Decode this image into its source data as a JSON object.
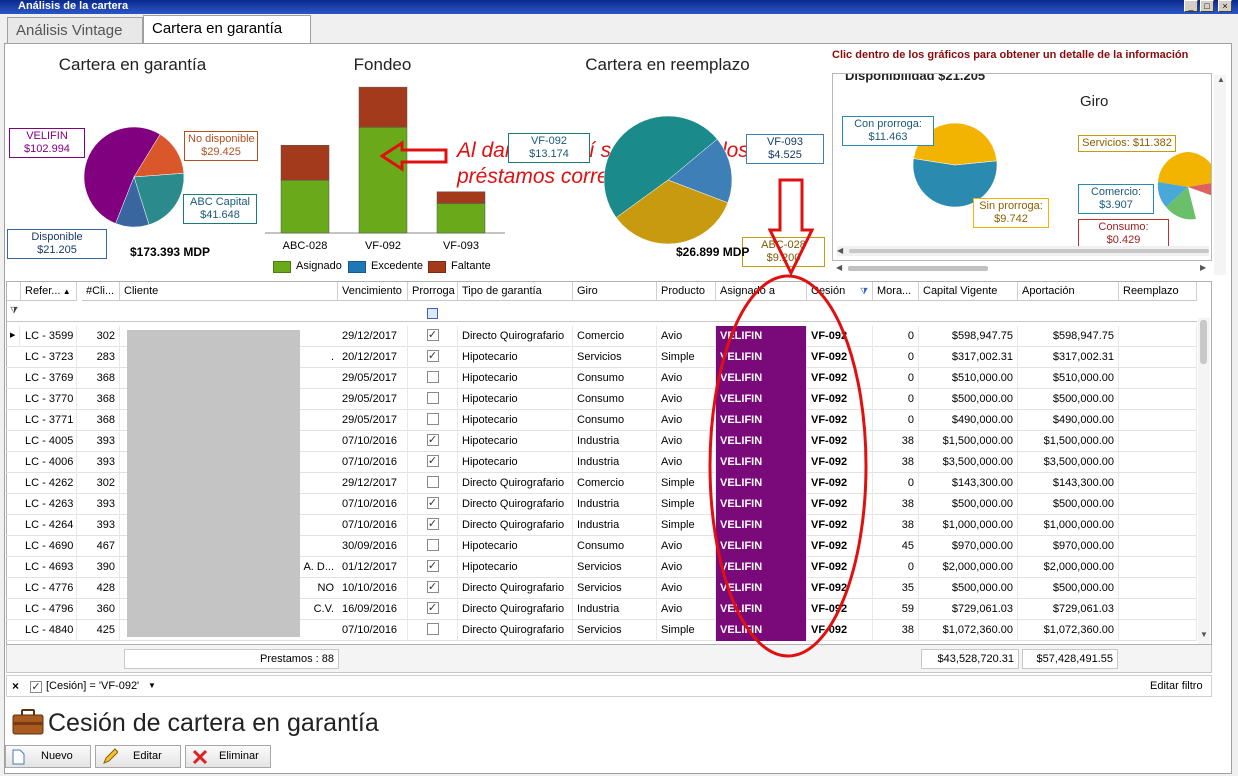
{
  "window": {
    "title": "Análisis de la cartera"
  },
  "tabs": [
    {
      "label": "Análisis Vintage"
    },
    {
      "label": "Cartera en garantía"
    }
  ],
  "charts": {
    "garantia": {
      "title": "Cartera en garantía",
      "total": "$173.393 MDP",
      "labels": {
        "velifin": "VELIFIN\n$102.994",
        "no_disp": "No disponible\n$29.425",
        "abc": "ABC Capital\n$41.648",
        "disp": "Disponible $21.205"
      }
    },
    "fondeo": {
      "title": "Fondeo",
      "annotation": "Al dar clic aquí se muestran los préstamos correspondientes",
      "legend": [
        "Asignado",
        "Excedente",
        "Faltante"
      ]
    },
    "reemplazo": {
      "title": "Cartera en reemplazo",
      "total": "$26.899 MDP",
      "labels": {
        "vf092": "VF-092 $13.174",
        "vf093": "VF-093 $4.525",
        "abc028": "ABC-028 $9.200"
      }
    },
    "detail_hint": "Clic dentro de los gráficos para obtener un detalle de la información",
    "disponibilidad": {
      "title": "Disponibilidad $21.205",
      "giro": "Giro",
      "labels": {
        "con": "Con prorroga:\n$11.463",
        "sin": "Sin prorroga:\n$9.742",
        "servicios": "Servicios: $11.382",
        "comercio": "Comercio:\n$3.907",
        "consumo": "Consumo: $0.429"
      }
    }
  },
  "chart_data": [
    {
      "type": "pie",
      "title": "Cartera en garantía",
      "categories": [
        "VELIFIN",
        "No disponible",
        "ABC Capital",
        "Disponible"
      ],
      "values": [
        102.994,
        29.425,
        41.648,
        21.205
      ],
      "colors": [
        "#800080",
        "#d9572b",
        "#2a8a8c",
        "#3a66a0"
      ]
    },
    {
      "type": "bar",
      "title": "Fondeo",
      "categories": [
        "ABC-028",
        "VF-092",
        "VF-093"
      ],
      "series": [
        {
          "name": "Asignado",
          "values": [
            50,
            100,
            28
          ],
          "color": "#6aaa1a"
        },
        {
          "name": "Excedente",
          "values": [
            0,
            0,
            0
          ],
          "color": "#1f78b4"
        },
        {
          "name": "Faltante",
          "values": [
            33,
            38,
            11
          ],
          "color": "#a33a1c"
        }
      ],
      "ylim": [
        0,
        140
      ]
    },
    {
      "type": "pie",
      "title": "Cartera en reemplazo",
      "categories": [
        "VF-092",
        "VF-093",
        "ABC-028"
      ],
      "values": [
        13.174,
        4.525,
        9.2
      ],
      "colors": [
        "#1a8a8a",
        "#3f7fb8",
        "#c89a10"
      ]
    },
    {
      "type": "pie",
      "title": "Disponibilidad $21.205",
      "categories": [
        "Con prorroga",
        "Sin prorroga"
      ],
      "values": [
        11.463,
        9.742
      ],
      "colors": [
        "#2b8ab0",
        "#f2b400"
      ]
    }
  ],
  "table": {
    "headers": [
      "Refer...",
      "#Cli...",
      "Cliente",
      "Vencimiento",
      "Prorroga",
      "Tipo de garantía",
      "Giro",
      "Producto",
      "Asignado a",
      "Cesión",
      "Mora...",
      "Capital Vigente",
      "Aportación",
      "Reemplazo"
    ],
    "rows": [
      {
        "ref": "LC - 3599",
        "cli": "302",
        "suffix": "",
        "venc": "29/12/2017",
        "pro": true,
        "tipo": "Directo Quirografario",
        "giro": "Comercio",
        "prod": "Avio",
        "asig": "VELIFIN",
        "ces": "VF-092",
        "mora": "0",
        "cap": "$598,947.75",
        "apo": "$598,947.75"
      },
      {
        "ref": "LC - 3723",
        "cli": "283",
        "suffix": ".",
        "venc": "20/12/2017",
        "pro": true,
        "tipo": "Hipotecario",
        "giro": "Servicios",
        "prod": "Simple",
        "asig": "VELIFIN",
        "ces": "VF-092",
        "mora": "0",
        "cap": "$317,002.31",
        "apo": "$317,002.31"
      },
      {
        "ref": "LC - 3769",
        "cli": "368",
        "suffix": "",
        "venc": "29/05/2017",
        "pro": false,
        "tipo": "Hipotecario",
        "giro": "Consumo",
        "prod": "Avio",
        "asig": "VELIFIN",
        "ces": "VF-092",
        "mora": "0",
        "cap": "$510,000.00",
        "apo": "$510,000.00"
      },
      {
        "ref": "LC - 3770",
        "cli": "368",
        "suffix": "",
        "venc": "29/05/2017",
        "pro": false,
        "tipo": "Hipotecario",
        "giro": "Consumo",
        "prod": "Avio",
        "asig": "VELIFIN",
        "ces": "VF-092",
        "mora": "0",
        "cap": "$500,000.00",
        "apo": "$500,000.00"
      },
      {
        "ref": "LC - 3771",
        "cli": "368",
        "suffix": "",
        "venc": "29/05/2017",
        "pro": false,
        "tipo": "Hipotecario",
        "giro": "Consumo",
        "prod": "Avio",
        "asig": "VELIFIN",
        "ces": "VF-092",
        "mora": "0",
        "cap": "$490,000.00",
        "apo": "$490,000.00"
      },
      {
        "ref": "LC - 4005",
        "cli": "393",
        "suffix": "",
        "venc": "07/10/2016",
        "pro": true,
        "tipo": "Hipotecario",
        "giro": "Industria",
        "prod": "Avio",
        "asig": "VELIFIN",
        "ces": "VF-092",
        "mora": "38",
        "cap": "$1,500,000.00",
        "apo": "$1,500,000.00"
      },
      {
        "ref": "LC - 4006",
        "cli": "393",
        "suffix": "",
        "venc": "07/10/2016",
        "pro": true,
        "tipo": "Hipotecario",
        "giro": "Industria",
        "prod": "Avio",
        "asig": "VELIFIN",
        "ces": "VF-092",
        "mora": "38",
        "cap": "$3,500,000.00",
        "apo": "$3,500,000.00"
      },
      {
        "ref": "LC - 4262",
        "cli": "302",
        "suffix": "",
        "venc": "29/12/2017",
        "pro": false,
        "tipo": "Directo Quirografario",
        "giro": "Comercio",
        "prod": "Simple",
        "asig": "VELIFIN",
        "ces": "VF-092",
        "mora": "0",
        "cap": "$143,300.00",
        "apo": "$143,300.00"
      },
      {
        "ref": "LC - 4263",
        "cli": "393",
        "suffix": "",
        "venc": "07/10/2016",
        "pro": true,
        "tipo": "Directo Quirografario",
        "giro": "Industria",
        "prod": "Simple",
        "asig": "VELIFIN",
        "ces": "VF-092",
        "mora": "38",
        "cap": "$500,000.00",
        "apo": "$500,000.00"
      },
      {
        "ref": "LC - 4264",
        "cli": "393",
        "suffix": "",
        "venc": "07/10/2016",
        "pro": true,
        "tipo": "Directo Quirografario",
        "giro": "Industria",
        "prod": "Simple",
        "asig": "VELIFIN",
        "ces": "VF-092",
        "mora": "38",
        "cap": "$1,000,000.00",
        "apo": "$1,000,000.00"
      },
      {
        "ref": "LC - 4690",
        "cli": "467",
        "suffix": "",
        "venc": "30/09/2016",
        "pro": false,
        "tipo": "Hipotecario",
        "giro": "Consumo",
        "prod": "Avio",
        "asig": "VELIFIN",
        "ces": "VF-092",
        "mora": "45",
        "cap": "$970,000.00",
        "apo": "$970,000.00"
      },
      {
        "ref": "LC - 4693",
        "cli": "390",
        "suffix": "A. D...",
        "venc": "01/12/2017",
        "pro": true,
        "tipo": "Hipotecario",
        "giro": "Servicios",
        "prod": "Avio",
        "asig": "VELIFIN",
        "ces": "VF-092",
        "mora": "0",
        "cap": "$2,000,000.00",
        "apo": "$2,000,000.00"
      },
      {
        "ref": "LC - 4776",
        "cli": "428",
        "suffix": "NO",
        "venc": "10/10/2016",
        "pro": true,
        "tipo": "Directo Quirografario",
        "giro": "Servicios",
        "prod": "Avio",
        "asig": "VELIFIN",
        "ces": "VF-092",
        "mora": "35",
        "cap": "$500,000.00",
        "apo": "$500,000.00"
      },
      {
        "ref": "LC - 4796",
        "cli": "360",
        "suffix": "C.V.",
        "venc": "16/09/2016",
        "pro": true,
        "tipo": "Directo Quirografario",
        "giro": "Industria",
        "prod": "Avio",
        "asig": "VELIFIN",
        "ces": "VF-092",
        "mora": "59",
        "cap": "$729,061.03",
        "apo": "$729,061.03"
      },
      {
        "ref": "LC - 4840",
        "cli": "425",
        "suffix": "",
        "venc": "07/10/2016",
        "pro": false,
        "tipo": "Directo Quirografario",
        "giro": "Servicios",
        "prod": "Simple",
        "asig": "VELIFIN",
        "ces": "VF-092",
        "mora": "38",
        "cap": "$1,072,360.00",
        "apo": "$1,072,360.00"
      }
    ],
    "footer": {
      "count": "Prestamos : 88",
      "capital": "$43,528,720.31",
      "aportacion": "$57,428,491.55"
    },
    "filter": {
      "text": "[Cesión] = 'VF-092'",
      "edit": "Editar filtro"
    }
  },
  "section_title": "Cesión de cartera en garantía",
  "buttons": {
    "nuevo": "Nuevo",
    "editar": "Editar",
    "eliminar": "Eliminar"
  }
}
